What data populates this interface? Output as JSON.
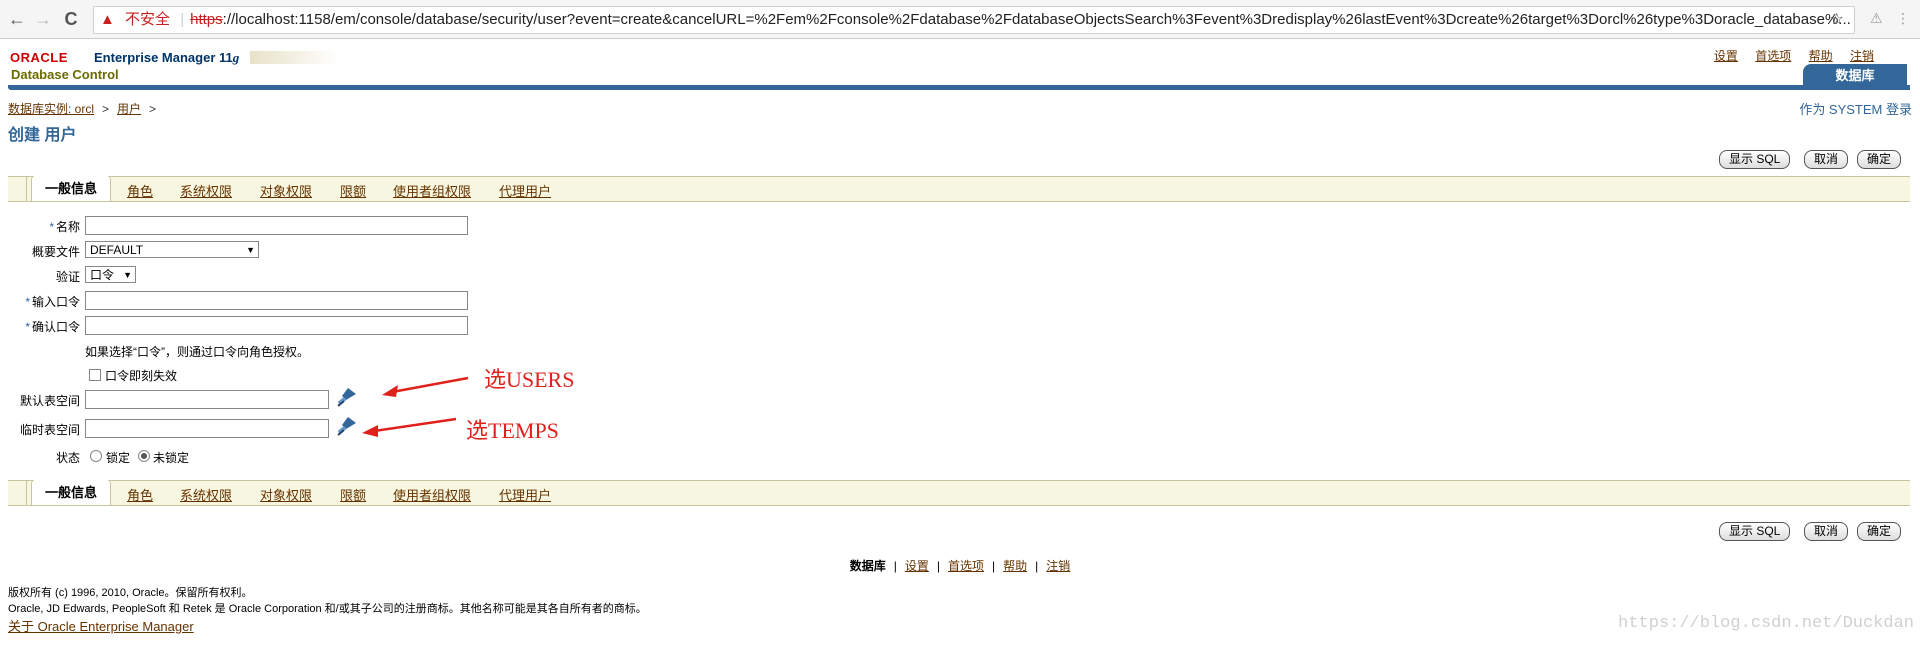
{
  "browser": {
    "back": "←",
    "forward": "→",
    "reload": "C",
    "security_warning": "不安全",
    "url_scheme": "https",
    "url_rest": "://localhost:1158/em/console/database/security/user?event=create&cancelURL=%2Fem%2Fconsole%2Fdatabase%2FdatabaseObjectsSearch%3Fevent%3Dredisplay%26lastEvent%3Dcreate%26target%3Dorcl%26type%3Doracle_database%..."
  },
  "header": {
    "oracle": "ORACLE",
    "em_title": "Enterprise Manager 11",
    "em_version_g": "g",
    "db_control": "Database Control",
    "global_links": [
      "设置",
      "首选项",
      "帮助",
      "注销"
    ],
    "db_tab": "数据库"
  },
  "breadcrumb": {
    "instance": "数据库实例: orcl",
    "users": "用户",
    "sep": ">"
  },
  "login_as": "作为 SYSTEM 登录",
  "page_title": "创建 用户",
  "buttons": {
    "show_sql": "显示 SQL",
    "cancel": "取消",
    "ok": "确定"
  },
  "tabs": [
    "一般信息",
    "角色",
    "系统权限",
    "对象权限",
    "限额",
    "使用者组权限",
    "代理用户"
  ],
  "form": {
    "name_label": "名称",
    "name_value": "",
    "profile_label": "概要文件",
    "profile_value": "DEFAULT",
    "auth_label": "验证",
    "auth_value": "口令",
    "password_label": "输入口令",
    "confirm_label": "确认口令",
    "password_hint": "如果选择“口令”，则通过口令向角色授权。",
    "expire_label": "口令即刻失效",
    "default_ts_label": "默认表空间",
    "default_ts_value": "",
    "temp_ts_label": "临时表空间",
    "temp_ts_value": "",
    "status_label": "状态",
    "locked_label": "锁定",
    "unlocked_label": "未锁定",
    "required_mark": "*"
  },
  "annotations": {
    "default_ts": "选USERS",
    "temp_ts": "选TEMPS",
    "color": "#e0201a"
  },
  "footer": {
    "links": [
      "数据库",
      "设置",
      "首选项",
      "帮助",
      "注销"
    ],
    "copyright": "版权所有 (c) 1996, 2010, Oracle。保留所有权利。",
    "trademark": "Oracle, JD Edwards, PeopleSoft 和 Retek 是 Oracle Corporation 和/或其子公司的注册商标。其他名称可能是其各自所有者的商标。",
    "about": "关于 Oracle Enterprise Manager"
  },
  "watermark": "https://blog.csdn.net/Duckdan",
  "colors": {
    "brand_blue": "#336699",
    "link_brown": "#663300",
    "oracle_red": "#cc0000"
  }
}
